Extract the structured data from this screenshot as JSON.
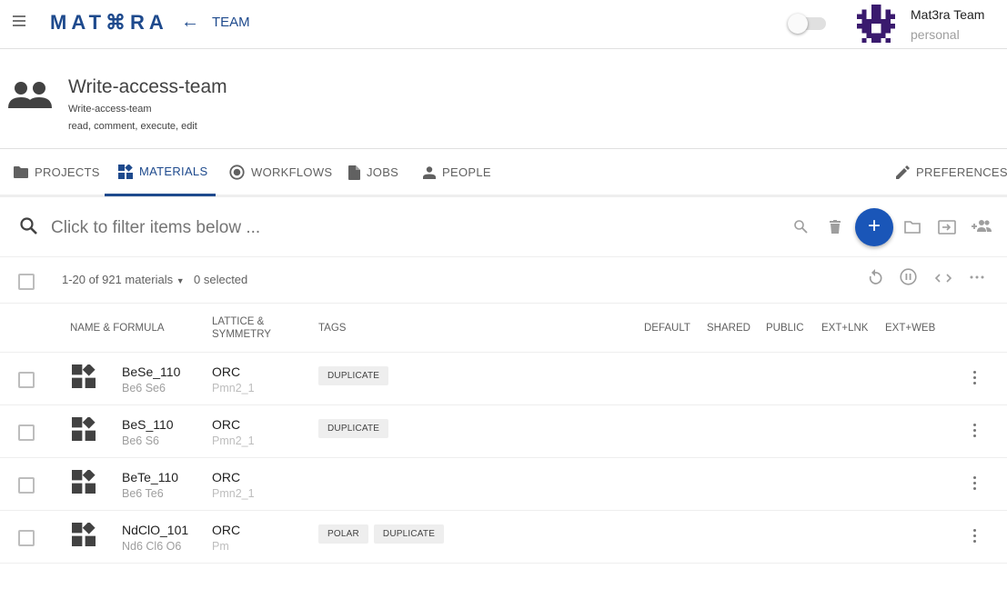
{
  "app": {
    "logo": "MAT⌘RA",
    "breadcrumb": "TEAM"
  },
  "user": {
    "name": "Mat3ra Team",
    "account": "personal"
  },
  "team": {
    "title": "Write-access-team",
    "subtitle": "Write-access-team",
    "permissions": "read, comment, execute, edit"
  },
  "tabs": [
    {
      "label": "PROJECTS",
      "icon": "folder-icon"
    },
    {
      "label": "MATERIALS",
      "icon": "materials-icon",
      "active": true
    },
    {
      "label": "WORKFLOWS",
      "icon": "workflow-icon"
    },
    {
      "label": "JOBS",
      "icon": "file-icon"
    },
    {
      "label": "PEOPLE",
      "icon": "person-icon"
    }
  ],
  "preferences_label": "PREFERENCES",
  "search": {
    "placeholder": "Click to filter items below ..."
  },
  "list": {
    "count": "1-20 of 921 materials",
    "selected": "0 selected"
  },
  "columns": {
    "name": "NAME & FORMULA",
    "lattice_1": "LATTICE &",
    "lattice_2": "SYMMETRY",
    "tags": "TAGS",
    "default": "DEFAULT",
    "shared": "SHARED",
    "public": "PUBLIC",
    "extlnk": "EXT+LNK",
    "extweb": "EXT+WEB"
  },
  "rows": [
    {
      "name": "BeSe_110",
      "formula": "Be6 Se6",
      "lattice": "ORC",
      "symmetry": "Pmn2_1",
      "tags": [
        "DUPLICATE"
      ]
    },
    {
      "name": "BeS_110",
      "formula": "Be6 S6",
      "lattice": "ORC",
      "symmetry": "Pmn2_1",
      "tags": [
        "DUPLICATE"
      ]
    },
    {
      "name": "BeTe_110",
      "formula": "Be6 Te6",
      "lattice": "ORC",
      "symmetry": "Pmn2_1",
      "tags": []
    },
    {
      "name": "NdClO_101",
      "formula": "Nd6 Cl6 O6",
      "lattice": "ORC",
      "symmetry": "Pm",
      "tags": [
        "POLAR",
        "DUPLICATE"
      ]
    }
  ],
  "colors": {
    "brand": "#1e4a8d",
    "fab": "#1a56b8"
  }
}
